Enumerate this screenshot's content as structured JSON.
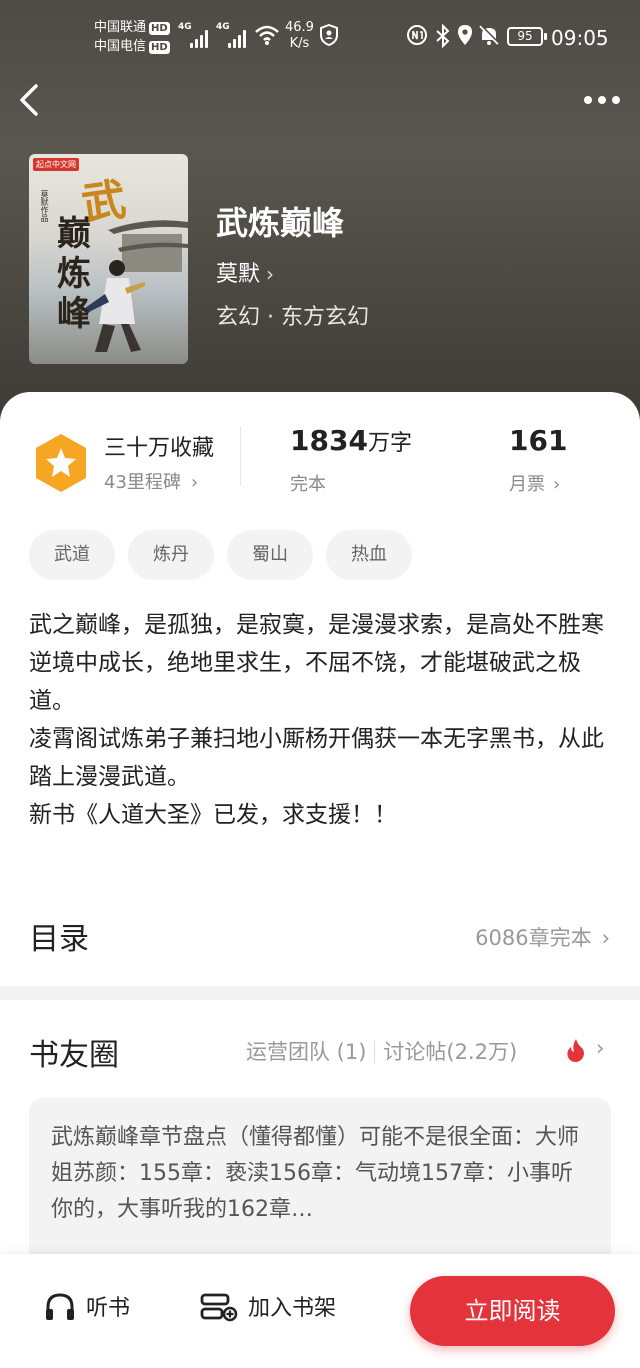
{
  "status_bar": {
    "carrier1": "中国联通",
    "carrier2": "中国电信",
    "hd": "HD",
    "net1": "4G",
    "net2": "4G",
    "speed_value": "46.9",
    "speed_unit": "K/s",
    "battery": "95",
    "time": "09:05"
  },
  "book": {
    "cover_publisher": "起点中文网",
    "cover_title_top": "武",
    "cover_title_main": "巅炼峰",
    "cover_author": "莫默作品",
    "title": "武炼巅峰",
    "author": "莫默",
    "genre": "玄幻 · 东方玄幻"
  },
  "stats": {
    "collect_label": "三十万收藏",
    "milestone": "43里程碑",
    "word_count_num": "1834",
    "word_count_unit": "万字",
    "status": "完本",
    "monthly_votes_num": "161",
    "monthly_votes_label": "月票"
  },
  "tags": [
    "武道",
    "炼丹",
    "蜀山",
    "热血"
  ],
  "description": [
    "武之巅峰，是孤独，是寂寞，是漫漫求索，是高处不胜寒",
    "逆境中成长，绝地里求生，不屈不饶，才能堪破武之极道。",
    "凌霄阁试炼弟子兼扫地小厮杨开偶获一本无字黑书，从此踏上漫漫武道。",
    "新书《人道大圣》已发，求支援！！"
  ],
  "toc": {
    "title": "目录",
    "meta": "6086章完本"
  },
  "circle": {
    "title": "书友圈",
    "ops_team": "运营团队 (1)",
    "discussions": "讨论帖(2.2万)",
    "post_text": "武炼巅峰章节盘点（懂得都懂）可能不是很全面：大师姐苏颜：155章：亵渎156章：气动境157章：小事听你的，大事听我的162章…"
  },
  "bottom": {
    "listen": "听书",
    "add_shelf": "加入书架",
    "read_now": "立即阅读"
  },
  "colors": {
    "accent_red": "#e5333b",
    "badge_orange": "#f6a623"
  }
}
